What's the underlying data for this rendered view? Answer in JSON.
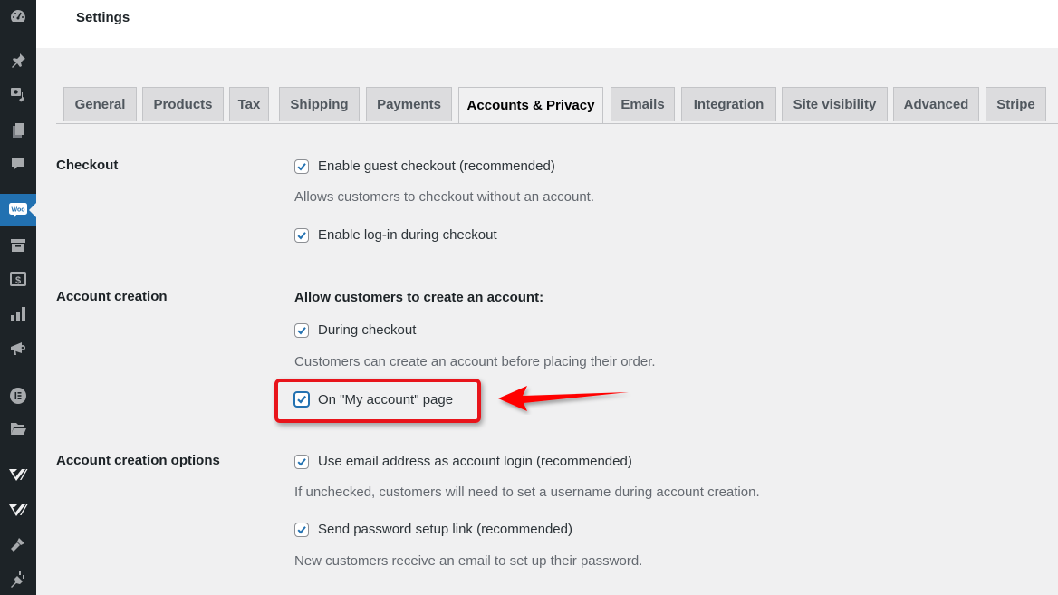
{
  "header": {
    "title": "Settings"
  },
  "sidebar": {
    "icons": [
      "dashboard-icon",
      "pin-icon",
      "media-icon",
      "pages-icon",
      "comments-icon",
      "woocommerce-icon",
      "products-archive-icon",
      "payments-dollar-icon",
      "analytics-icon",
      "marketing-megaphone-icon",
      "elementor-icon",
      "folder-icon",
      "wpvivid-icon",
      "wpvivid-icon-2",
      "appearance-brush-icon",
      "plugins-icon"
    ],
    "active": "woocommerce-icon",
    "woo_label": "Woo"
  },
  "tabs": [
    {
      "label": "General",
      "active": false
    },
    {
      "label": "Products",
      "active": false
    },
    {
      "label": "Tax",
      "active": false
    },
    {
      "label": "Shipping",
      "active": false
    },
    {
      "label": "Payments",
      "active": false
    },
    {
      "label": "Accounts & Privacy",
      "active": true
    },
    {
      "label": "Emails",
      "active": false
    },
    {
      "label": "Integration",
      "active": false
    },
    {
      "label": "Site visibility",
      "active": false
    },
    {
      "label": "Advanced",
      "active": false
    },
    {
      "label": "Stripe",
      "active": false
    }
  ],
  "sections": {
    "checkout": {
      "label": "Checkout",
      "guest_checkout": {
        "label": "Enable guest checkout (recommended)",
        "checked": true
      },
      "guest_checkout_desc": "Allows customers to checkout without an account.",
      "login_checkout": {
        "label": "Enable log-in during checkout",
        "checked": true
      }
    },
    "account_creation": {
      "label": "Account creation",
      "subheading": "Allow customers to create an account:",
      "during_checkout": {
        "label": "During checkout",
        "checked": true
      },
      "during_checkout_desc": "Customers can create an account before placing their order.",
      "my_account_page": {
        "label": "On \"My account\" page",
        "checked": true,
        "highlighted": true
      }
    },
    "account_creation_options": {
      "label": "Account creation options",
      "email_login": {
        "label": "Use email address as account login (recommended)",
        "checked": true
      },
      "email_login_desc": "If unchecked, customers will need to set a username during account creation.",
      "password_link": {
        "label": "Send password setup link (recommended)",
        "checked": true
      },
      "password_link_desc": "New customers receive an email to set up their password."
    }
  },
  "annotation": {
    "color": "#e8141b",
    "type": "highlight-box-with-arrow"
  },
  "colors": {
    "accent": "#2271b1",
    "sidebar": "#1d2327",
    "background": "#f0f0f1"
  }
}
